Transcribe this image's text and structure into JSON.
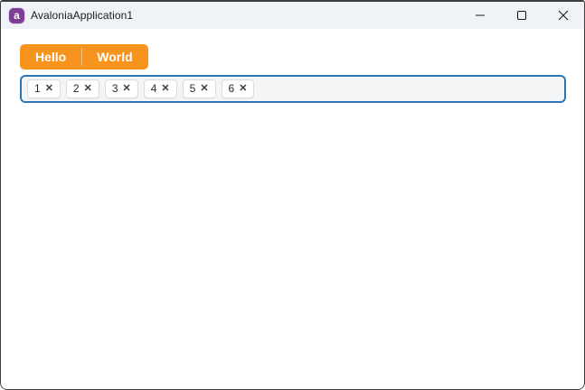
{
  "window": {
    "title": "AvaloniaApplication1"
  },
  "icons": {
    "app_logo_letter": "a",
    "minimize": "minimize-dash",
    "maximize": "maximize-square",
    "close": "close-x"
  },
  "tabs": [
    {
      "label": "Hello"
    },
    {
      "label": "World"
    }
  ],
  "chips": {
    "close_glyph": "✕",
    "items": [
      "1",
      "2",
      "3",
      "4",
      "5",
      "6"
    ]
  },
  "colors": {
    "accent_orange": "#f7941d",
    "focus_border_blue": "#2c74b8",
    "titlebar_bg": "#eff3f8",
    "window_border": "#3c3c3c",
    "logo_purple": "#7e3d97"
  }
}
